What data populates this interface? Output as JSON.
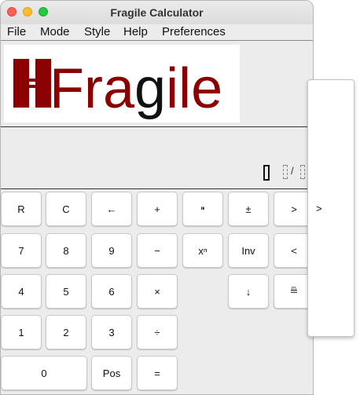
{
  "window": {
    "title": "Fragile Calculator"
  },
  "menu": [
    "File",
    "Mode",
    "Style",
    "Help",
    "Preferences"
  ],
  "logo": {
    "text": "Fragile"
  },
  "display": {
    "fraction_slash": "/"
  },
  "buttons": {
    "r1": [
      "R",
      "C",
      "←",
      "+",
      "⁍",
      "±",
      ">"
    ],
    "r2": [
      "7",
      "8",
      "9",
      "−",
      "xⁿ",
      "Inv",
      "<"
    ],
    "r3": [
      "4",
      "5",
      "6",
      "×",
      "↓",
      "≞"
    ],
    "r4": [
      "1",
      "2",
      "3",
      "÷"
    ],
    "r5": [
      "0",
      "Pos",
      "="
    ]
  },
  "popup": {
    "arrow": ">"
  },
  "colors": {
    "logo_red": "#8b0000",
    "logo_dark": "#111111"
  }
}
